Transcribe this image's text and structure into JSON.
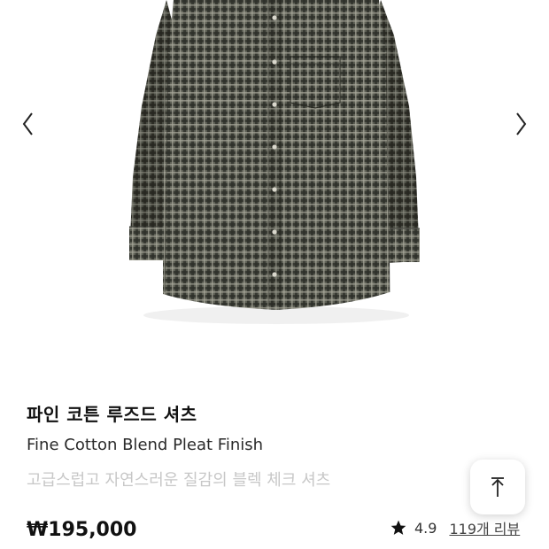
{
  "product": {
    "title_kr": "파인 코튼 루즈드 셔츠",
    "title_en": "Fine Cotton Blend Pleat Finish",
    "description": "고급스럽고 자연스러운 질감의 블렉 체크 셔츠",
    "price": "₩195,000",
    "rating": "4.9",
    "reviews_label": "119개 리뷰"
  },
  "icons": {
    "prev": "chevron-left-icon",
    "next": "chevron-right-icon",
    "star": "star-icon",
    "scroll_top": "arrow-up-to-top-icon"
  },
  "colors": {
    "shirt_base": "#5d5f55",
    "check_dark": "#2c2d28",
    "check_light": "#a9a99c",
    "muted_text": "#c7c7c7"
  }
}
